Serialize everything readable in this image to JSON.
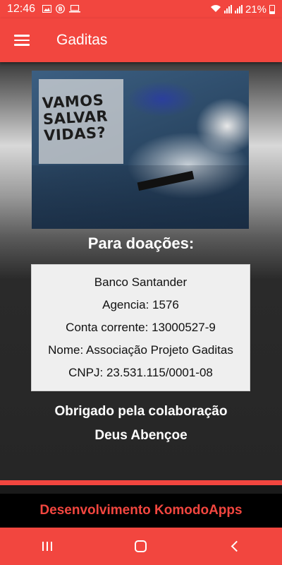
{
  "status_bar": {
    "time": "12:46",
    "battery": "21%",
    "icons": [
      "image-icon",
      "b-badge-icon",
      "laptop-icon",
      "wifi-icon",
      "signal-icon",
      "battery-icon"
    ]
  },
  "app_bar": {
    "title": "Gaditas",
    "menu_icon": "hamburger-menu-icon"
  },
  "banner": {
    "text": "VAMOS\nSALVAR\nVIDAS?"
  },
  "donation": {
    "heading": "Para doações:",
    "bank": "Banco Santander",
    "agency": "Agencia: 1576",
    "account": "Conta corrente: 13000527-9",
    "name": "Nome: Associação Projeto Gaditas",
    "cnpj": "CNPJ: 23.531.115/0001-08"
  },
  "messages": {
    "thanks": "Obrigado pela colaboração",
    "blessing": "Deus Abençoe"
  },
  "footer": {
    "text": "Desenvolvimento KomodoApps"
  },
  "nav_bar": {
    "buttons": [
      "recents-icon",
      "home-icon",
      "back-icon"
    ]
  },
  "colors": {
    "accent": "#f2463f",
    "card_bg": "#efefef"
  }
}
